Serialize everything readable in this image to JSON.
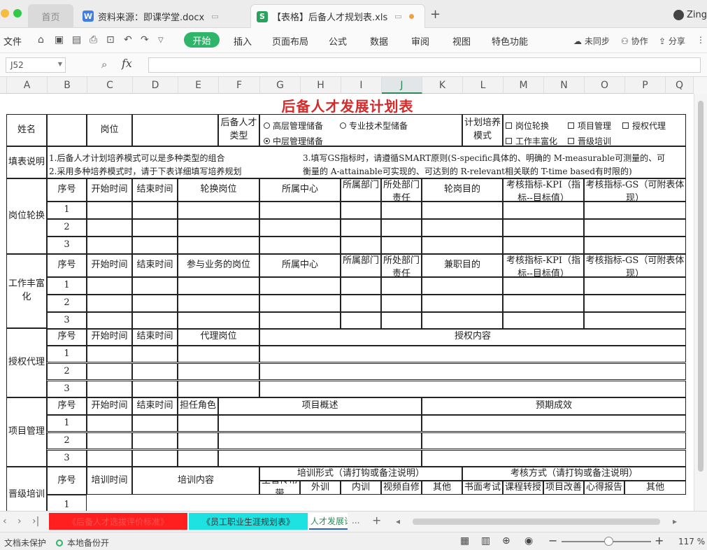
{
  "browser_tabs": {
    "home": "首页",
    "doc": "资料来源：即课学堂.docx",
    "xls": "【表格】后备人才规划表.xls",
    "user": "Zing"
  },
  "menu": {
    "file": "文件",
    "start": "开始",
    "items": [
      "插入",
      "页面布局",
      "公式",
      "数据",
      "审阅",
      "视图",
      "特色功能"
    ],
    "sync": "未同步",
    "collab": "协作",
    "share": "分享"
  },
  "formula": {
    "cell_ref": "J52",
    "fx": "fx",
    "value": ""
  },
  "columns": [
    "A",
    "B",
    "C",
    "D",
    "E",
    "F",
    "G",
    "H",
    "I",
    "J",
    "K",
    "L",
    "M",
    "N",
    "O",
    "P",
    "Q"
  ],
  "sheet": {
    "title": "后备人才发展计划表",
    "name_label": "姓名",
    "post_label": "岗位",
    "reserve_type_label": "后备人才类型",
    "reserve_options": [
      "高层管理储备",
      "专业技术型储备",
      "中层管理储备"
    ],
    "plan_mode_label": "计划培养模式",
    "plan_options": [
      "岗位轮换",
      "项目管理",
      "授权代理",
      "工作丰富化",
      "晋级培训"
    ],
    "fill_notes_label": "填表说明",
    "notes": [
      "1.后备人才计划培养模式可以是多种类型的组合",
      "2.采用多种培养模式时，请于下表详细填写培养规划",
      "3.填写GS指标时，请遵循SMART原则(S-specific具体的、明确的  M-measurable可测量的、可",
      "衡量的  A-attainable可实现的、可达到的  R-relevant相关联的  T-time based有时限的)"
    ],
    "sections": {
      "rotation": {
        "label": "岗位轮换",
        "headers": [
          "序号",
          "开始时间",
          "结束时间",
          "轮换岗位",
          "所属中心",
          "所属部门",
          "所处部门责任",
          "轮岗目的",
          "考核指标-KPI（指标--目标值）",
          "考核指标-GS（可附表体现）"
        ]
      },
      "enrichment": {
        "label": "工作丰富化",
        "headers": [
          "序号",
          "开始时间",
          "结束时间",
          "参与业务的岗位",
          "所属中心",
          "所属部门",
          "所处部门责任",
          "兼职目的",
          "考核指标-KPI（指标--目标值）",
          "考核指标-GS（可附表体现）"
        ]
      },
      "delegation": {
        "label": "授权代理",
        "headers": [
          "序号",
          "开始时间",
          "结束时间",
          "代理岗位",
          "授权内容"
        ]
      },
      "project": {
        "label": "项目管理",
        "headers": [
          "序号",
          "开始时间",
          "结束时间",
          "担任角色",
          "项目概述",
          "预期成效"
        ]
      },
      "promotion": {
        "label": "晋级培训",
        "headers": [
          "序号",
          "培训时间",
          "培训内容",
          "培训形式（请打钩或备注说明）",
          "考核方式（请打钩或备注说明）"
        ],
        "train_forms": [
          "主管传帮带",
          "外训",
          "内训",
          "视频自修",
          "其他"
        ],
        "assess_forms": [
          "书面考试",
          "课程转授",
          "项目改善",
          "心得报告",
          "其他"
        ]
      }
    },
    "row_numbers": [
      "1",
      "2",
      "3"
    ]
  },
  "sheet_tabs": {
    "tab1": "《后备人才选拔评价标准》",
    "tab2": "《员工职业生涯规划表》",
    "tab3": "人才发展计",
    "more": "..."
  },
  "status": {
    "protect": "文档未保护",
    "backup": "本地备份开",
    "zoom": "117 %"
  }
}
